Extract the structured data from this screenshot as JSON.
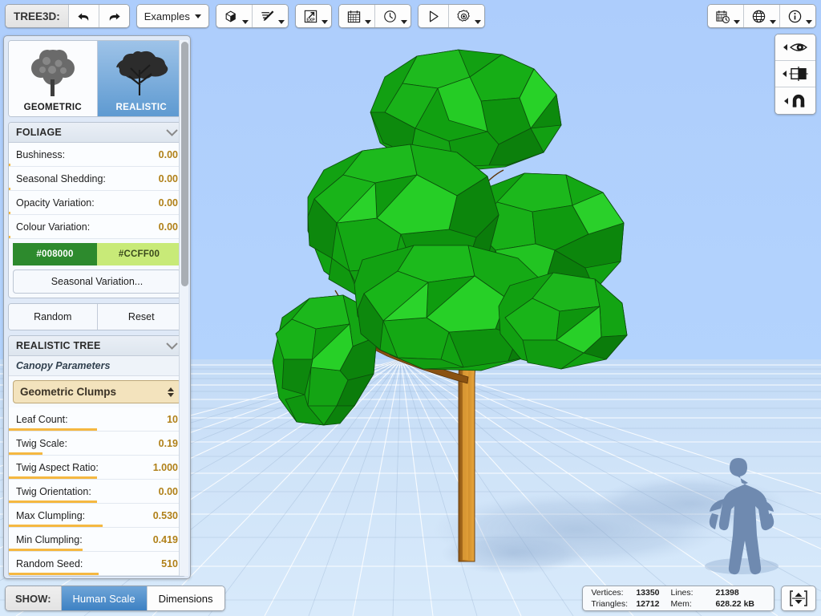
{
  "app": {
    "title": "TREE3D:"
  },
  "toolbar": {
    "undo_icon": "undo-arrow-icon",
    "redo_icon": "redo-arrow-icon",
    "examples_label": "Examples",
    "shape_icon": "cube-shape-icon",
    "edit_icon": "pencil-lines-icon",
    "export_label": "EXP",
    "export_icon": "export-arrow-icon",
    "calendar_icon": "calendar-icon",
    "clock_icon": "clock-icon",
    "play_icon": "play-triangle-icon",
    "settings_icon": "gear-icon",
    "schedule_icon": "calendar-clock-icon",
    "globe_icon": "globe-icon",
    "info_icon": "info-circle-icon"
  },
  "rightbar": {
    "items": [
      {
        "name": "view-eye",
        "icon": "eye-icon"
      },
      {
        "name": "split-view",
        "icon": "split-panel-icon"
      },
      {
        "name": "snap-magnet",
        "icon": "magnet-icon"
      }
    ]
  },
  "panel": {
    "types": [
      {
        "label": "GEOMETRIC",
        "active": false
      },
      {
        "label": "REALISTIC",
        "active": true
      }
    ],
    "foliage": {
      "header": "FOLIAGE",
      "params": [
        {
          "name": "Bushiness:",
          "value": "0.00",
          "fill": 1
        },
        {
          "name": "Seasonal Shedding:",
          "value": "0.00",
          "fill": 1
        },
        {
          "name": "Opacity Variation:",
          "value": "0.00",
          "fill": 1
        },
        {
          "name": "Colour Variation:",
          "value": "0.00",
          "fill": 1
        }
      ],
      "colors": [
        {
          "label": "#008000",
          "hex": "#2d8a2d",
          "text": "#ffffff"
        },
        {
          "label": "#CCFF00",
          "hex": "#c8ea78",
          "text": "#3b4a1d"
        }
      ],
      "seasonal_button": "Seasonal Variation...",
      "random_button": "Random",
      "reset_button": "Reset"
    },
    "realistic": {
      "header": "REALISTIC TREE",
      "subhead": "Canopy Parameters",
      "dropdown_value": "Geometric Clumps",
      "params": [
        {
          "name": "Leaf Count:",
          "value": "10",
          "fill": 50
        },
        {
          "name": "Twig Scale:",
          "value": "0.19",
          "fill": 19
        },
        {
          "name": "Twig Aspect Ratio:",
          "value": "1.000",
          "fill": 50
        },
        {
          "name": "Twig Orientation:",
          "value": "0.00",
          "fill": 50
        },
        {
          "name": "Max Clumpling:",
          "value": "0.530",
          "fill": 53
        },
        {
          "name": "Min Clumpling:",
          "value": "0.419",
          "fill": 42
        },
        {
          "name": "Random Seed:",
          "value": "510",
          "fill": 51
        }
      ]
    }
  },
  "show": {
    "label": "SHOW:",
    "tabs": [
      {
        "label": "Human Scale",
        "active": true
      },
      {
        "label": "Dimensions",
        "active": false
      }
    ]
  },
  "stats": {
    "vertices_key": "Vertices:",
    "vertices_val": "13350",
    "triangles_key": "Triangles:",
    "triangles_val": "12712",
    "lines_key": "Lines:",
    "lines_val": "21398",
    "mem_key": "Mem:",
    "mem_val": "628.22 kB",
    "expand_icon": "expand-vertical-icon"
  },
  "colors": {
    "sky": "#b0d0fd",
    "ground": "#cfe3f8",
    "foliage_green": "#17a617",
    "trunk_brown": "#c8821f",
    "accent_orange": "#f5b841",
    "active_blue": "#3d81c3"
  }
}
